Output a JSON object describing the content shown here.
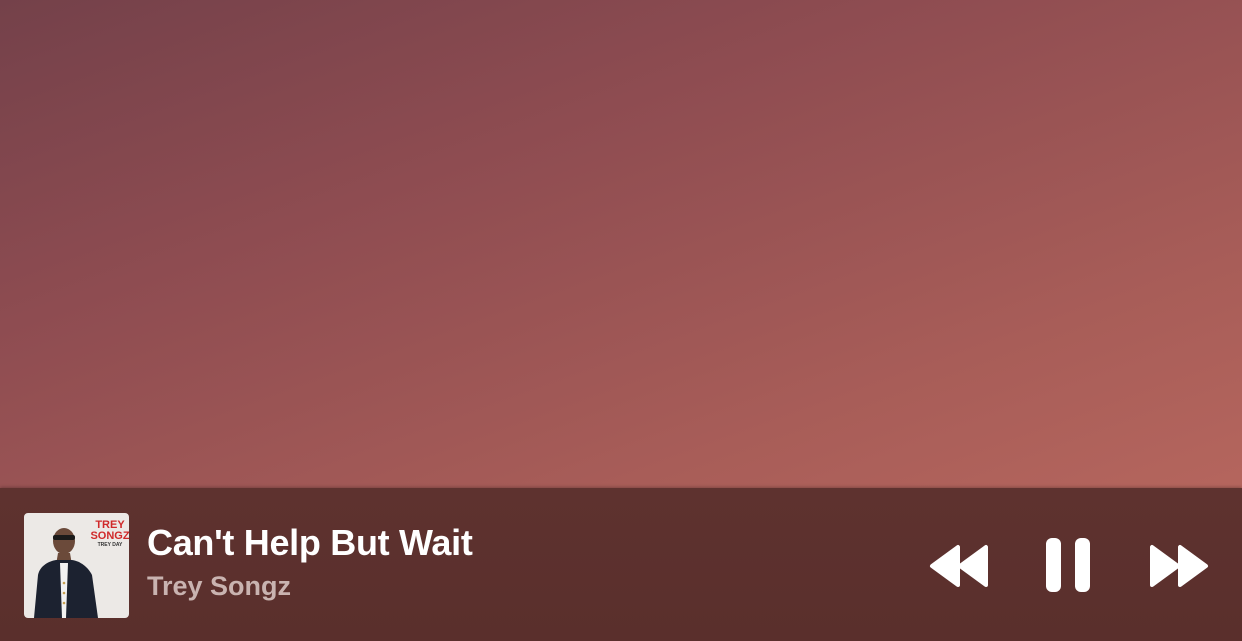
{
  "now_playing": {
    "title": "Can't Help But Wait",
    "artist": "Trey Songz",
    "artwork": {
      "icon": "album-artwork",
      "text_top": "TREY",
      "text_mid": "SONGZ",
      "text_sub": "TREY DAY"
    }
  },
  "controls": {
    "rewind_icon": "rewind-icon",
    "pause_icon": "pause-icon",
    "forward_icon": "fast-forward-icon"
  },
  "colors": {
    "background_top": "#74414a",
    "background_bottom": "#bd6b61",
    "player_bar": "#5e322f",
    "title": "#ffffff",
    "artist": "#c9b3b0"
  }
}
